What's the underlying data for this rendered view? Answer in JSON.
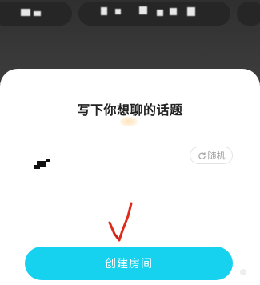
{
  "sheet": {
    "title": "写下你想聊的话题",
    "random_label": "随机",
    "random_icon": "refresh-icon"
  },
  "actions": {
    "create_room_label": "创建房间"
  },
  "colors": {
    "accent": "#16d2ef",
    "annotation": "#e02a1a"
  }
}
